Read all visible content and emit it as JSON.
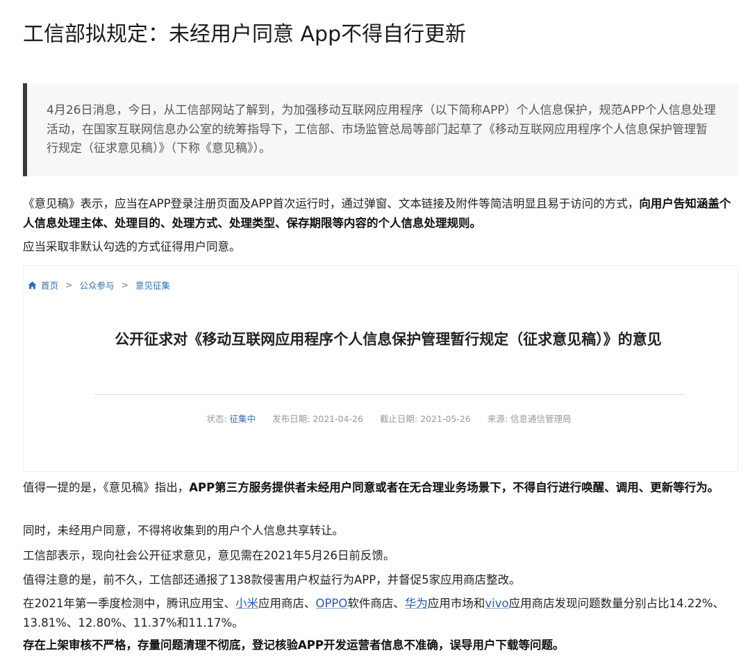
{
  "article": {
    "title": "工信部拟规定：未经用户同意 App不得自行更新",
    "quote": "4月26日消息，今日，从工信部网站了解到，为加强移动互联网应用程序（以下简称APP）个人信息保护，规范APP个人信息处理活动，在国家互联网信息办公室的统筹指导下，工信部、市场监管总局等部门起草了《移动互联网应用程序个人信息保护管理暂行规定（征求意见稿）》（下称《意见稿》）。",
    "p1_normal": "《意见稿》表示，应当在APP登录注册页面及APP首次运行时，通过弹窗、文本链接及附件等简洁明显且易于访问的方式，",
    "p1_bold": "向用户告知涵盖个人信息处理主体、处理目的、处理方式、处理类型、保存期限等内容的个人信息处理规则。",
    "p2": "应当采取非默认勾选的方式征得用户同意。",
    "p3_normal": "值得一提的是，《意见稿》指出，",
    "p3_bold": "APP第三方服务提供者未经用户同意或者在无合理业务场景下，不得自行进行唤醒、调用、更新等行为。",
    "p4": "同时，未经用户同意，不得将收集到的用户个人信息共享转让。",
    "p5": "工信部表示，现向社会公开征求意见，意见需在2021年5月26日前反馈。",
    "p6": "值得注意的是，前不久，工信部还通报了138款侵害用户权益行为APP，并督促5家应用商店整改。",
    "p7": {
      "t1": "在2021年第一季度检测中，腾讯应用宝、",
      "l1": "小米",
      "t2": "应用商店、",
      "l2": "OPPO",
      "t3": "软件商店、",
      "l3": "华为",
      "t4": "应用市场和",
      "l4": "vivo",
      "t5": "应用商店发现问题数量分别占比14.22%、13.81%、12.80%、11.37%和11.17%。"
    },
    "p8_bold": "存在上架审核不严格，存量问题清理不彻底，登记核验APP开发运营者信息不准确，误导用户下载等问题。"
  },
  "embed": {
    "breadcrumb": {
      "home": "首页",
      "sep1": ">",
      "item2": "公众参与",
      "sep2": ">",
      "item3": "意见征集"
    },
    "notice_title": "公开征求对《移动互联网应用程序个人信息保护管理暂行规定（征求意见稿）》的意见",
    "meta": {
      "status_label": "状态:",
      "status_value": "征集中",
      "publish_label": "发布日期:",
      "publish_date": "2021-04-26",
      "deadline_label": "截止日期:",
      "deadline_date": "2021-05-26",
      "source_label": "来源:",
      "source_value": "信息通信管理局"
    }
  },
  "colors": {
    "link": "#2b5aa8",
    "breadcrumb": "#2f6db5",
    "quote_bg": "#f7f7f7",
    "quote_bar": "#3a3a3a"
  }
}
